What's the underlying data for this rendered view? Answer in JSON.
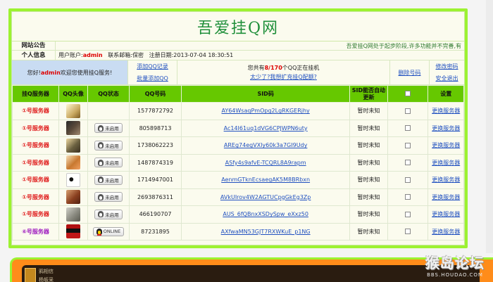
{
  "site": {
    "title": "吾爱挂Q网"
  },
  "notice": {
    "label": "网站公告",
    "text": "吾爱挂Q网处于起步阶段,许多功能并不完善,有"
  },
  "user_info": {
    "label": "个人信息",
    "account_prefix": "用户账户:",
    "account": "admin",
    "email_label": "联系邮箱:",
    "email_value": "保密",
    "reg_label": "注册日期:",
    "reg_date": "2013-07-04 18:30:51"
  },
  "welcome": {
    "prefix": "您好!",
    "user": "admin",
    "suffix": " 欢迎您使用挂Q服务!"
  },
  "actions": {
    "add_qq": "添加QQ记录",
    "batch_add": "批量添加QQ",
    "count_prefix": "您共有",
    "count_value": "8/170",
    "count_suffix": "个QQ正在挂机",
    "bind_link": "太少了?我想扩充挂Q配额?",
    "delete": "删除号码",
    "change_password": "修改密码",
    "logout": "安全退出"
  },
  "table": {
    "headers": [
      "挂Q服务器",
      "QQ头像",
      "QQ状态",
      "QQ号码",
      "SID码",
      "SID能否自动更新",
      "",
      "设置"
    ],
    "rows": [
      {
        "server": "①号服务器",
        "status": "",
        "qq": "1577872792",
        "sid": "AY64WsaqPmOpg2LgRKGERjhy",
        "auto": "暂时未知",
        "setting": "更换服务器"
      },
      {
        "server": "①号服务器",
        "status": "未启用",
        "qq": "805898713",
        "sid": "Ac14I61uq1dVG6CPJWPN6uty",
        "auto": "暂时未知",
        "setting": "更换服务器"
      },
      {
        "server": "①号服务器",
        "status": "未启用",
        "qq": "1738062223",
        "sid": "AREg74egVXly60k3a7GI9Udy",
        "auto": "暂时未知",
        "setting": "更换服务器"
      },
      {
        "server": "①号服务器",
        "status": "未启用",
        "qq": "1487874319",
        "sid": "ASfy4s9afvE-TCQRL8A9rapm",
        "auto": "暂时未知",
        "setting": "更换服务器"
      },
      {
        "server": "①号服务器",
        "status": "未启用",
        "qq": "1714947001",
        "sid": "AenmGTknEcsaegAK5M8BRbxn",
        "auto": "暂时未知",
        "setting": "更换服务器"
      },
      {
        "server": "①号服务器",
        "status": "未启用",
        "qq": "2693876311",
        "sid": "AVkUIrov4W2AGTUCpgGkEg3Zp",
        "auto": "暂时未知",
        "setting": "更换服务器"
      },
      {
        "server": "①号服务器",
        "status": "未启用",
        "qq": "466190707",
        "sid": "AUS_6fQBnxXSDySpw_eXxz50",
        "auto": "暂时未知",
        "setting": "更换服务器"
      },
      {
        "server": "⑥号服务器",
        "status": "ONLINE",
        "qq": "87231895",
        "sid": "AXfwaMN53GJT7RXWKuE_p1NG",
        "auto": "暂时未知",
        "setting": "更换服务器"
      }
    ]
  },
  "bottom": {
    "line1": "鸦相信",
    "line2": "杨坂采"
  },
  "watermark": {
    "main": "猴岛论坛",
    "sub": "BBS.HOUDAO.COM"
  },
  "colors": {
    "frame": "#9cf231",
    "header": "#66c800",
    "title": "#1f8f3a",
    "server": "#e02020",
    "link": "#2050c0"
  }
}
